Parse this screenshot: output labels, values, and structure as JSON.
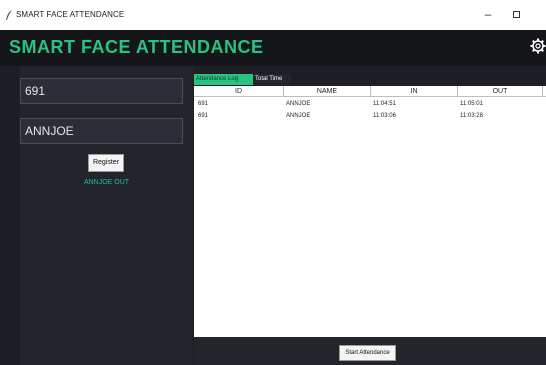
{
  "window": {
    "title": "SMART FACE ATTENDANCE",
    "minimize_glyph": "–"
  },
  "header": {
    "title": "SMART FACE ATTENDANCE",
    "accent_color": "#29c281",
    "settings_icon": "gear-icon"
  },
  "left_panel": {
    "id_value": "691",
    "name_value": "ANNJOE",
    "register_label": "Register",
    "status_text": "ANNJOE OUT"
  },
  "tabs": [
    {
      "label": "Attendance Log",
      "active": true
    },
    {
      "label": "Total Time",
      "active": false
    }
  ],
  "table": {
    "columns": [
      "ID",
      "NAME",
      "IN",
      "OUT"
    ],
    "rows": [
      [
        "691",
        "ANNJOE",
        "11:04:51",
        "11:05:01"
      ],
      [
        "691",
        "ANNJOE",
        "11:03:06",
        "11:03:28"
      ]
    ]
  },
  "bottom": {
    "start_label": "Start Attendance"
  }
}
